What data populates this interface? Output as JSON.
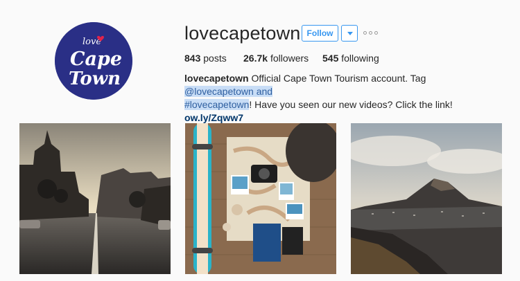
{
  "profile": {
    "username": "lovecapetown",
    "follow_label": "Follow",
    "avatar_text": {
      "line1": "love",
      "line2": "Cape",
      "line3": "Town"
    }
  },
  "stats": {
    "posts_count": "843",
    "posts_label": "posts",
    "followers_count": "26.7k",
    "followers_label": "followers",
    "following_count": "545",
    "following_label": "following"
  },
  "bio": {
    "name": "lovecapetown",
    "text_part1": " Official Cape Town Tourism account. Tag ",
    "highlight1": "@lovecapetown and",
    "highlight2": "#lovecapetown",
    "text_part2": "! Have you seen our new videos? Click the link! ",
    "link": "ow.ly/Zqww7"
  },
  "posts": [
    {
      "subject": "city street at sunset"
    },
    {
      "subject": "skateboard, camera and map flat lay"
    },
    {
      "subject": "Lion's Head mountain view"
    }
  ],
  "colors": {
    "accent": "#3897f0",
    "avatar_bg": "#2a2f86",
    "highlight": "#c8ddf6"
  }
}
